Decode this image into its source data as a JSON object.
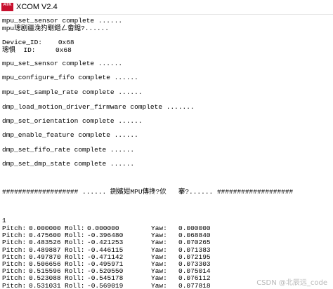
{
  "window": {
    "icon_text": "ATK",
    "title": "XCOM V2.4"
  },
  "terminal": {
    "lines": [
      "mpu_set_sensor complete ......",
      "mpu璁剧疆浼犳劅鍣ㄥ畬鎴?......",
      "Device_ID:    0x68",
      "璁惧  ID:     0x68",
      "mpu_set_sensor complete ......",
      "mpu_configure_fifo complete ......",
      "mpu_set_sample_rate complete ......",
      "dmp_load_motion_driver_firmware complete .......",
      "dmp_set_orientation complete ......",
      "dmp_enable_feature complete ......",
      "dmp_set_fifo_rate complete ......",
      "dmp_set_dmp_state complete ......",
      "################### ...... 鍘嬪姏MPU傳搀?佽   搴?...... ###################",
      "1"
    ],
    "data_rows": [
      {
        "pitch_label": "Pitch:",
        "pitch": "0.000000",
        "roll_label": "Roll:",
        "roll": "0.000000",
        "yaw_label": "Yaw:",
        "yaw": "0.000000"
      },
      {
        "pitch_label": "Pitch:",
        "pitch": "0.475600",
        "roll_label": "Roll:",
        "roll": "-0.396480",
        "yaw_label": "Yaw:",
        "yaw": "0.068840"
      },
      {
        "pitch_label": "Pitch:",
        "pitch": "0.483526",
        "roll_label": "Roll:",
        "roll": "-0.421253",
        "yaw_label": "Yaw:",
        "yaw": "0.070265"
      },
      {
        "pitch_label": "Pitch:",
        "pitch": "0.489887",
        "roll_label": "Roll:",
        "roll": "-0.446115",
        "yaw_label": "Yaw:",
        "yaw": "0.071383"
      },
      {
        "pitch_label": "Pitch:",
        "pitch": "0.497870",
        "roll_label": "Roll:",
        "roll": "-0.471142",
        "yaw_label": "Yaw:",
        "yaw": "0.072195"
      },
      {
        "pitch_label": "Pitch:",
        "pitch": "0.506656",
        "roll_label": "Roll:",
        "roll": "-0.495971",
        "yaw_label": "Yaw:",
        "yaw": "0.073303"
      },
      {
        "pitch_label": "Pitch:",
        "pitch": "0.515596",
        "roll_label": "Roll:",
        "roll": "-0.520550",
        "yaw_label": "Yaw:",
        "yaw": "0.075014"
      },
      {
        "pitch_label": "Pitch:",
        "pitch": "0.523088",
        "roll_label": "Roll:",
        "roll": "-0.545178",
        "yaw_label": "Yaw:",
        "yaw": "0.076112"
      },
      {
        "pitch_label": "Pitch:",
        "pitch": "0.531031",
        "roll_label": "Roll:",
        "roll": "-0.569019",
        "yaw_label": "Yaw:",
        "yaw": "0.077818"
      }
    ]
  },
  "watermark": "CSDN @北辰远_code",
  "colors": {
    "icon_background": "#c8102e",
    "terminal_background": "#ffffff",
    "terminal_text": "#000000",
    "watermark_text": "#b8b8b8"
  }
}
